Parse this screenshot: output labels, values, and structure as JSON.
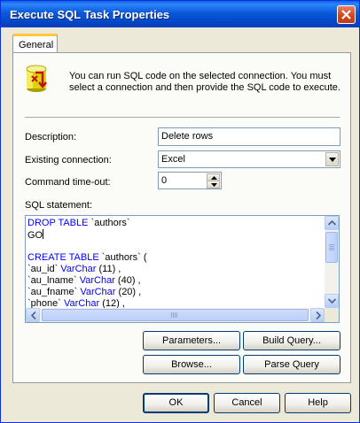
{
  "window": {
    "title": "Execute SQL Task Properties"
  },
  "tabs": [
    {
      "label": "General"
    }
  ],
  "info": {
    "text_line1": "You can run SQL code on the selected connection.  You must",
    "text_line2": "select a connection and then provide the SQL code to execute."
  },
  "fields": {
    "description_label": "Description:",
    "description_value": "Delete rows",
    "connection_label": "Existing connection:",
    "connection_value": "Excel",
    "timeout_label": "Command time-out:",
    "timeout_value": "0",
    "sql_label": "SQL statement:"
  },
  "sql": {
    "lines": [
      {
        "kw": "DROP TABLE",
        "rest": " `authors`"
      },
      {
        "kw": "",
        "rest": "GO"
      },
      {
        "kw": "",
        "rest": ""
      },
      {
        "kw": "CREATE TABLE",
        "rest": " `authors` ("
      },
      {
        "pre": "`au_id` ",
        "kw": "VarChar",
        "rest": " (11) ,"
      },
      {
        "pre": "`au_lname` ",
        "kw": "VarChar",
        "rest": " (40) ,"
      },
      {
        "pre": "`au_fname` ",
        "kw": "VarChar",
        "rest": " (20) ,"
      },
      {
        "pre": "`phone` ",
        "kw": "VarChar",
        "rest": " (12) ,"
      }
    ]
  },
  "buttons": {
    "parameters": "Parameters...",
    "build_query": "Build Query...",
    "browse": "Browse...",
    "parse_query": "Parse Query",
    "ok": "OK",
    "cancel": "Cancel",
    "help": "Help"
  },
  "colors": {
    "sql_keyword": "#0000ff",
    "title_bar": "#0a59da",
    "dialog_bg": "#ece9d8"
  }
}
